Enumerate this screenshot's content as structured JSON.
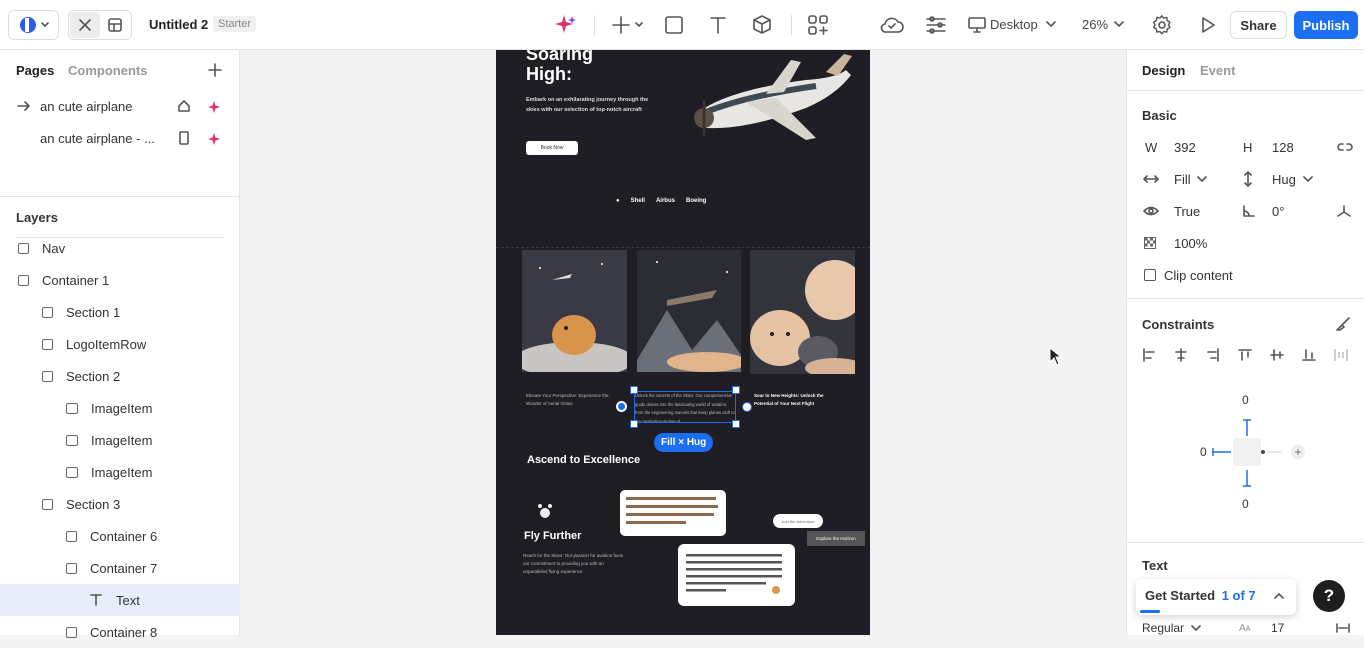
{
  "topbar": {
    "project_name": "Untitled 2",
    "plan_badge": "Starter",
    "device": "Desktop",
    "zoom": "26%",
    "share": "Share",
    "publish": "Publish"
  },
  "left": {
    "tabs": [
      "Pages",
      "Components"
    ],
    "pages": [
      "an cute airplane",
      "an cute airplane - ..."
    ],
    "layers_title": "Layers",
    "layers": [
      "Nav",
      "Container 1",
      "Section 1",
      "LogoItemRow",
      "Section 2",
      "ImageItem",
      "ImageItem",
      "ImageItem",
      "Section 3",
      "Container 6",
      "Container 7",
      "Text",
      "Container 8"
    ]
  },
  "site": {
    "hero_title_1": "Soaring",
    "hero_title_2": "High:",
    "hero_desc": "Embark on an exhilarating journey through the skies with our selection of top-notch aircraft",
    "book_now": "Book Now",
    "logos": [
      "Shell",
      "Airbus",
      "Boeing"
    ],
    "cap1": "Elevate Your Perspective: Experience the Wonder of Aerial Vistas",
    "cap2": "Unlock the Secrets of the Skies: Our comprehensive guide delves into the fascinating world of aviation, from the engineering marvels that keep planes aloft to the captivating stories of",
    "cap3": "Soar to New Heights: Unlock the Potential of Your Next Flight",
    "fill_hug": "Fill × Hug",
    "ascend": "Ascend to Excellence",
    "fly_further": "Fly Further",
    "fly_desc": "Reach for the Skies: Our passion for aviation fuels our commitment to providing you with an unparalleled flying experience",
    "join": "Join the Adventure",
    "explore": "Explore the Horizon"
  },
  "right": {
    "tabs": [
      "Design",
      "Event"
    ],
    "basic": "Basic",
    "w_label": "W",
    "w_value": "392",
    "h_label": "H",
    "h_value": "128",
    "width_mode": "Fill",
    "height_mode": "Hug",
    "visible": "True",
    "rotation": "0°",
    "opacity": "100%",
    "clip": "Clip content",
    "constraints": "Constraints",
    "c_top": "0",
    "c_left": "0",
    "c_bottom": "0",
    "text_section": "Text",
    "get_started": "Get Started",
    "progress": "1 of 7",
    "font_weight": "Regular",
    "font_size": "17",
    "help": "?"
  },
  "colors": {
    "accent": "#1c6ef2",
    "site_bg": "#1e1e24"
  }
}
